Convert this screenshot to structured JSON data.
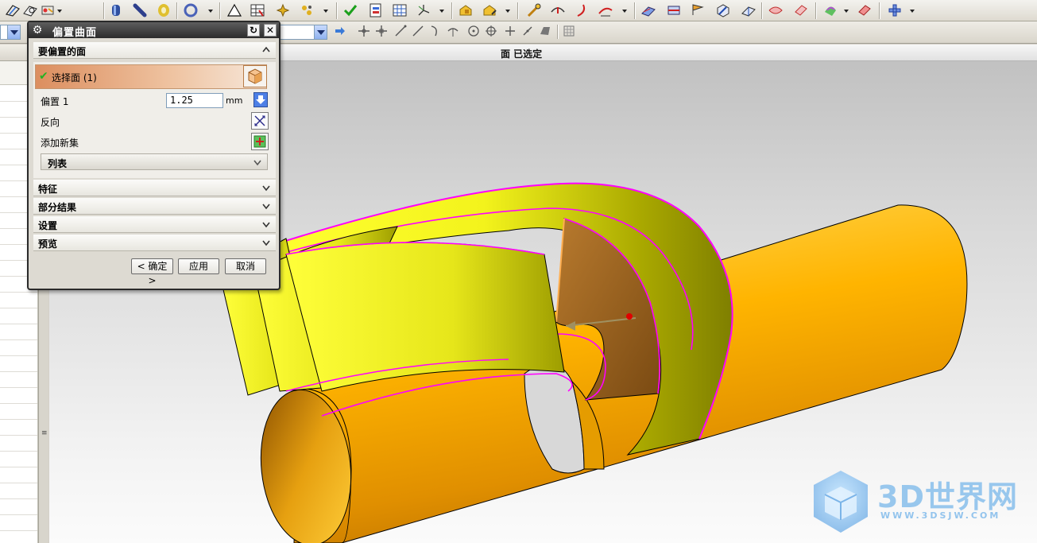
{
  "dialog": {
    "title": "偏置曲面",
    "faces_section": "要偏置的面",
    "select_face": "选择面 (1)",
    "offset_label": "偏置 1",
    "offset_value": "1.25",
    "offset_unit": "mm",
    "reverse_label": "反向",
    "add_set_label": "添加新集",
    "list_label": "列表",
    "sections": [
      "特征",
      "部分结果",
      "设置",
      "预览"
    ],
    "buttons": {
      "ok": "< 确定 >",
      "apply": "应用",
      "cancel": "取消"
    }
  },
  "viewport": {
    "status": "面 已选定"
  },
  "watermark": {
    "text": "3D世界网",
    "url": "WWW.3DSJW.COM"
  },
  "icons": {
    "toolbar": [
      "sketch-icon",
      "sketch-plane-icon",
      "datum-icon",
      "cylinder-icon",
      "pipe-icon",
      "coil-icon",
      "wheel-icon",
      "triangle-icon",
      "table-icon",
      "point-icon",
      "sphere-icon",
      "check-icon",
      "document-icon",
      "grid-icon",
      "axes-icon",
      "cheese-icon",
      "cheese-edit-icon",
      "measure-icon",
      "curve-icon",
      "arc-icon",
      "edge-icon",
      "surface-icon",
      "surface-edit-icon",
      "flag-icon",
      "cube-edit-icon",
      "flow-icon",
      "ribbon-icon",
      "sheet-icon",
      "paint-icon",
      "eraser-icon",
      "grid-shape-icon"
    ],
    "snap": [
      "arrow-right-icon",
      "move-icon",
      "move-point-icon",
      "line-icon",
      "arc-snap-icon",
      "tangent-icon",
      "perpendicular-icon",
      "circle-center-icon",
      "quadrant-icon",
      "plus-icon",
      "slash-icon",
      "face-snap-icon",
      "grid-snap-icon"
    ]
  },
  "colors": {
    "accent": "#e7a070",
    "surface": "#d6d600",
    "cylinder": "#f2a800",
    "edge_highlight": "#ff00ff"
  }
}
